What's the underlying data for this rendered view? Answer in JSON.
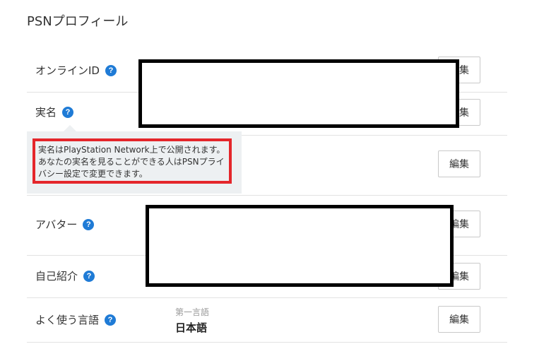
{
  "page": {
    "title": "PSNプロフィール"
  },
  "rows": {
    "online_id": {
      "label": "オンラインID"
    },
    "real_name": {
      "label": "実名"
    },
    "avatar": {
      "label": "アバター"
    },
    "about_me": {
      "label": "自己紹介"
    },
    "languages": {
      "label": "よく使う言語",
      "sub_label": "第一言語",
      "value": "日本語"
    }
  },
  "tooltip": {
    "text": "実名はPlayStation Network上で公開されます。あなたの実名を見ることができる人はPSNプライバシー設定で変更できます。"
  },
  "buttons": {
    "edit_label": "編集"
  },
  "help": {
    "icon_glyph": "?",
    "icon_name": "help-icon"
  },
  "colors": {
    "help_icon": "#1f7bd6",
    "highlight_border": "#e4262b",
    "tooltip_bg": "#edf0f2"
  }
}
